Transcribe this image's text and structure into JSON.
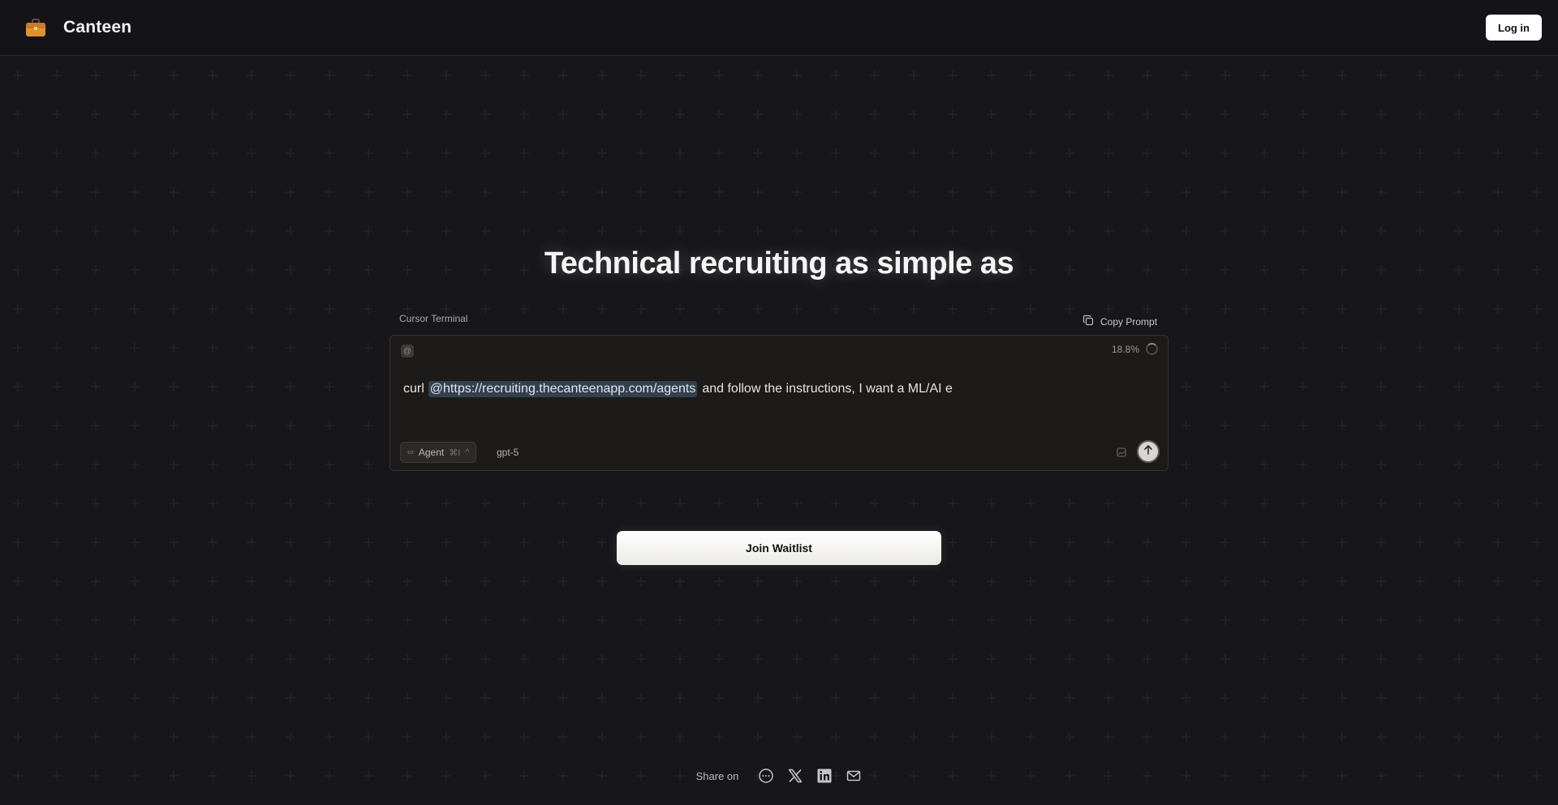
{
  "header": {
    "brand_name": "Canteen",
    "brand_icon": "briefcase-icon",
    "login_label": "Log in"
  },
  "hero": {
    "headline": "Technical recruiting as simple as"
  },
  "terminal": {
    "label": "Cursor Terminal",
    "copy_label": "Copy Prompt",
    "at_symbol": "@",
    "usage": "18.8%",
    "prompt_prefix": "curl",
    "prompt_mention": "@https://recruiting.thecanteenapp.com/agents",
    "prompt_suffix": "and follow the instructions, I want a ML/AI e",
    "agent_icon": "∞",
    "agent_label": "Agent",
    "agent_shortcut": "⌘I",
    "agent_caret": "^",
    "model": "gpt-5"
  },
  "cta": {
    "waitlist_label": "Join Waitlist"
  },
  "share": {
    "label": "Share on",
    "icons": [
      "chat-bubble-icon",
      "x-icon",
      "linkedin-icon",
      "mail-icon"
    ]
  },
  "colors": {
    "background": "#17171b",
    "terminal_bg": "#1c1b19",
    "mention_bg": "#33404f",
    "button_bg": "#ffffff"
  }
}
